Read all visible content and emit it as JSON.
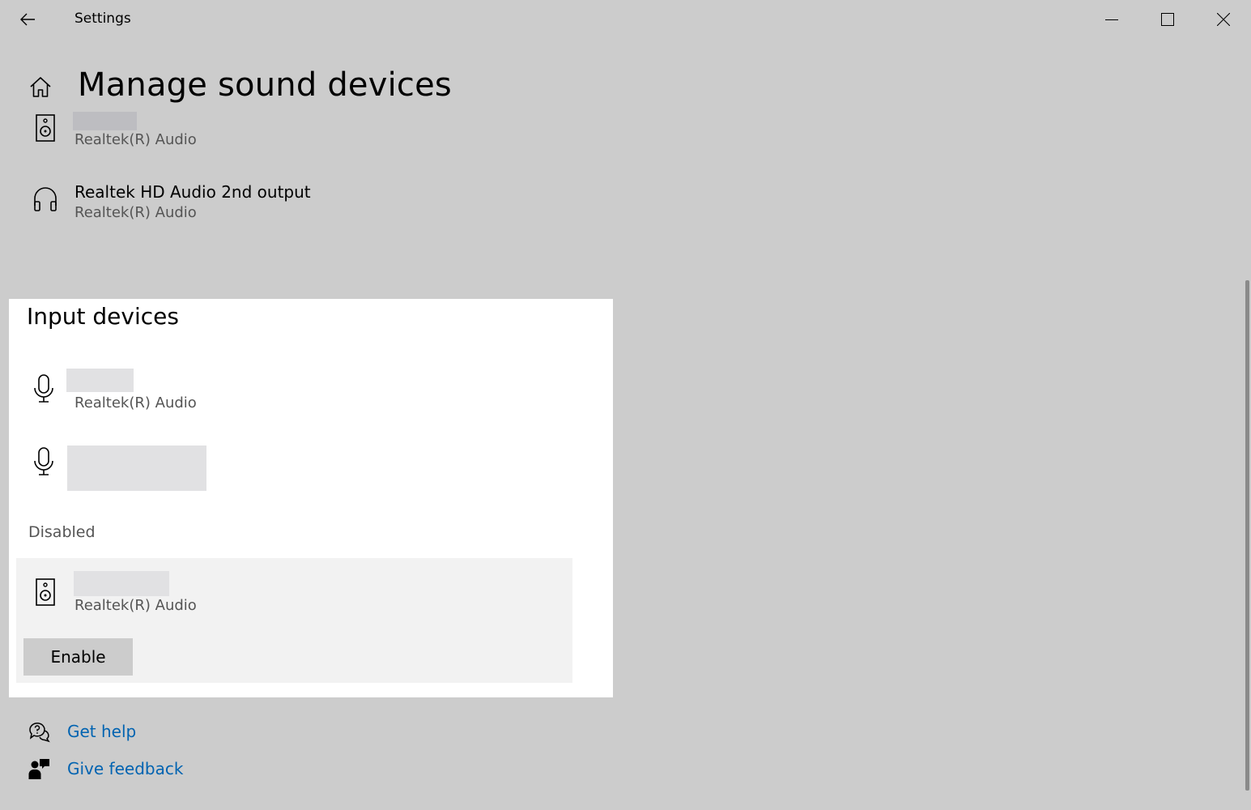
{
  "titlebar": {
    "title": "Settings",
    "icons": {
      "back": "back-arrow-icon",
      "minimize": "minimize-icon",
      "maximize": "maximize-icon",
      "close": "close-icon"
    }
  },
  "header": {
    "title": "Manage sound devices",
    "icon": "home-icon"
  },
  "output_devices": [
    {
      "name": "",
      "name_redacted": true,
      "driver": "Realtek(R) Audio",
      "icon": "speaker-icon"
    },
    {
      "name": "Realtek HD Audio 2nd output",
      "driver": "Realtek(R) Audio",
      "icon": "headphones-icon"
    }
  ],
  "input_section": {
    "title": "Input devices",
    "devices": [
      {
        "name": "",
        "name_redacted": true,
        "driver": "Realtek(R) Audio",
        "icon": "microphone-icon"
      },
      {
        "name": "",
        "name_redacted": true,
        "driver": "",
        "icon": "microphone-icon"
      }
    ],
    "disabled_label": "Disabled",
    "disabled_devices": [
      {
        "name": "",
        "name_redacted": true,
        "driver": "Realtek(R) Audio",
        "icon": "speaker-icon",
        "action_label": "Enable"
      }
    ]
  },
  "help": {
    "get_help": "Get help",
    "give_feedback": "Give feedback"
  },
  "colors": {
    "background": "#cccccc",
    "panel": "#ffffff",
    "selected_row": "#f2f2f2",
    "link": "#0063b1",
    "redaction": "#e1e1e3"
  }
}
